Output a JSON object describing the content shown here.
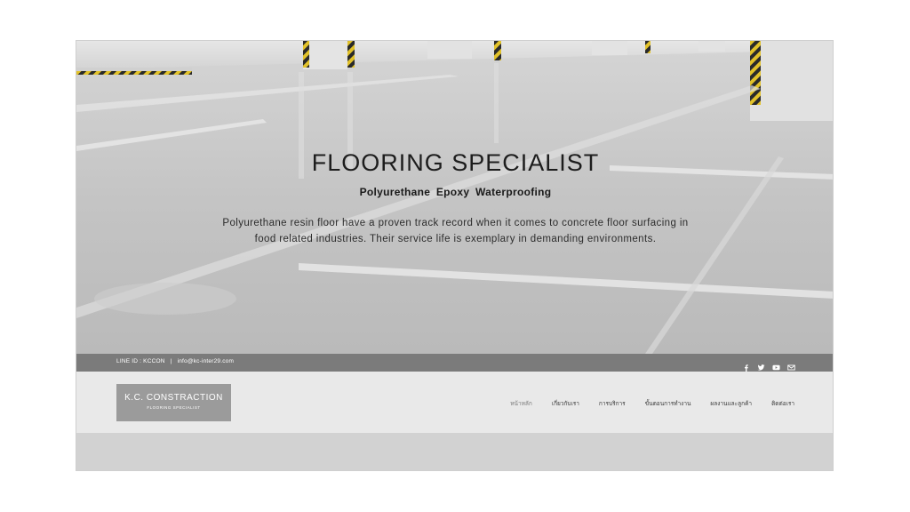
{
  "hero": {
    "title": "FLOORING SPECIALIST",
    "subtitle": "Polyurethane  Epoxy  Waterproofing",
    "description": "Polyurethane resin floor have a proven track record when it comes to concrete floor surfacing in food related industries. Their service life is exemplary in demanding environments."
  },
  "topbar": {
    "line_id": "LINE ID : KCCON",
    "separator": "|",
    "email": "info@kc-inter29.com",
    "socials": [
      "facebook-icon",
      "twitter-icon",
      "youtube-icon",
      "mail-icon"
    ]
  },
  "logo": {
    "name": "K.C. CONSTRACTION",
    "tagline": "FLOORING SPECIALIST"
  },
  "nav": {
    "items": [
      {
        "label": "หน้าหลัก",
        "active": true
      },
      {
        "label": "เกี่ยวกับเรา"
      },
      {
        "label": "การบริการ"
      },
      {
        "label": "ขั้นตอนการทำงาน"
      },
      {
        "label": "ผลงานและลูกค้า"
      },
      {
        "label": "ติดต่อเรา"
      }
    ]
  },
  "colors": {
    "topbar_bg": "#7b7b7b",
    "header_bg": "#e9e9e9",
    "logo_bg": "#9b9b9b",
    "hazard_yellow": "#e2c22a"
  }
}
